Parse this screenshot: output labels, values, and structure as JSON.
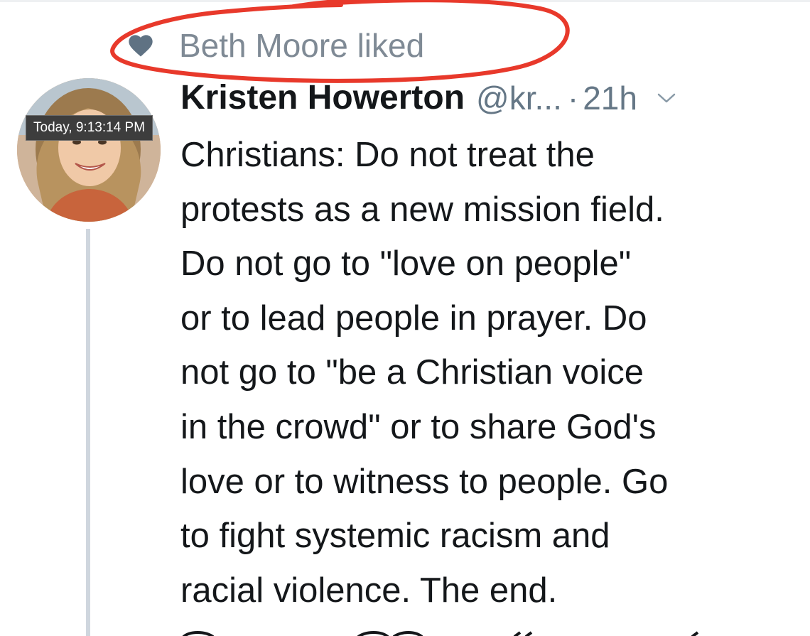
{
  "context": {
    "text": "Beth Moore liked",
    "icon": "heart-icon"
  },
  "annotation": {
    "color": "#e8392b"
  },
  "tooltip": {
    "text": "Today, 9:13:14 PM"
  },
  "tweet": {
    "author_name": "Kristen Howerton",
    "handle": "@kr...",
    "separator": "·",
    "time": "21h",
    "lines": [
      "Christians: Do not treat the",
      "protests as a new mission field.",
      "Do not go to \"love on people\"",
      "or to lead people in prayer. Do",
      "not go to \"be a Christian voice",
      "in the crowd\" or to share God's",
      "love or to witness to people. Go",
      "to fight systemic racism and",
      "racial violence. The end."
    ]
  },
  "colors": {
    "text": "#14171a",
    "secondary": "#657786",
    "context": "#7f8a95",
    "heart": "#5f7283",
    "thread": "#cfd6de"
  }
}
